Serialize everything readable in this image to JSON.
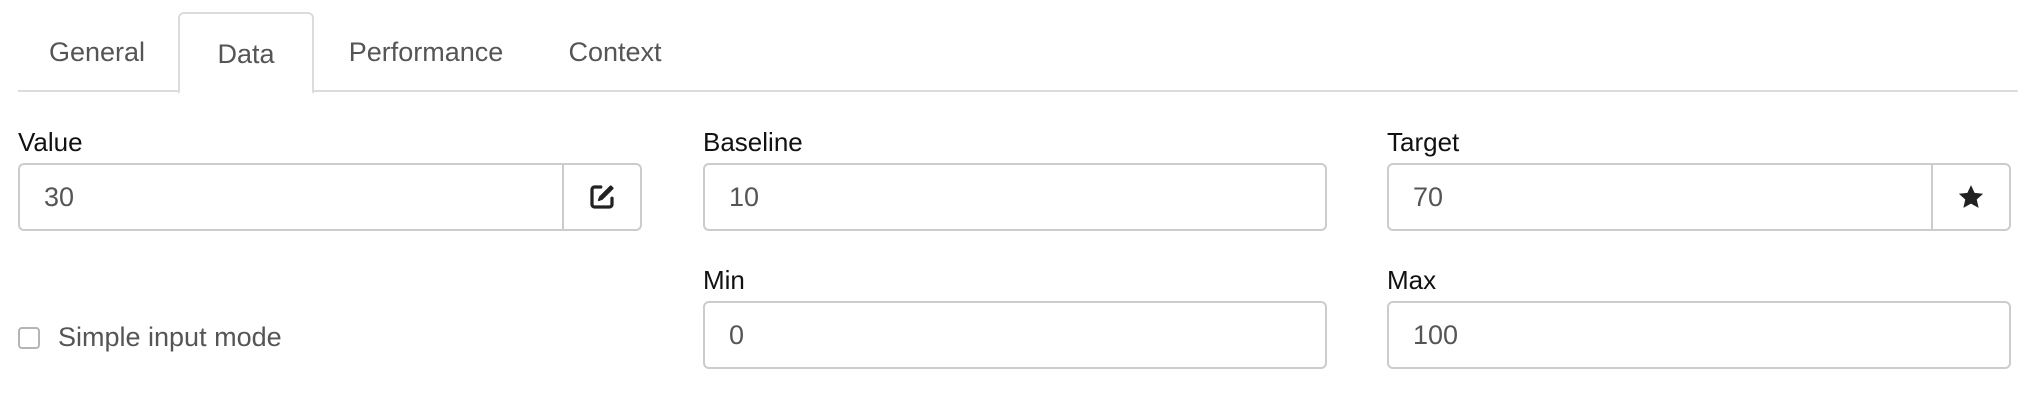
{
  "tabs": [
    {
      "label": "General"
    },
    {
      "label": "Data"
    },
    {
      "label": "Performance"
    },
    {
      "label": "Context"
    }
  ],
  "active_tab": "Data",
  "fields": {
    "value": {
      "label": "Value",
      "value": "30",
      "addon_icon": "edit-icon"
    },
    "baseline": {
      "label": "Baseline",
      "value": "10"
    },
    "target": {
      "label": "Target",
      "value": "70",
      "addon_icon": "star-icon"
    },
    "min": {
      "label": "Min",
      "value": "0"
    },
    "max": {
      "label": "Max",
      "value": "100"
    }
  },
  "simple_input_mode": {
    "label": "Simple input mode",
    "checked": false
  }
}
